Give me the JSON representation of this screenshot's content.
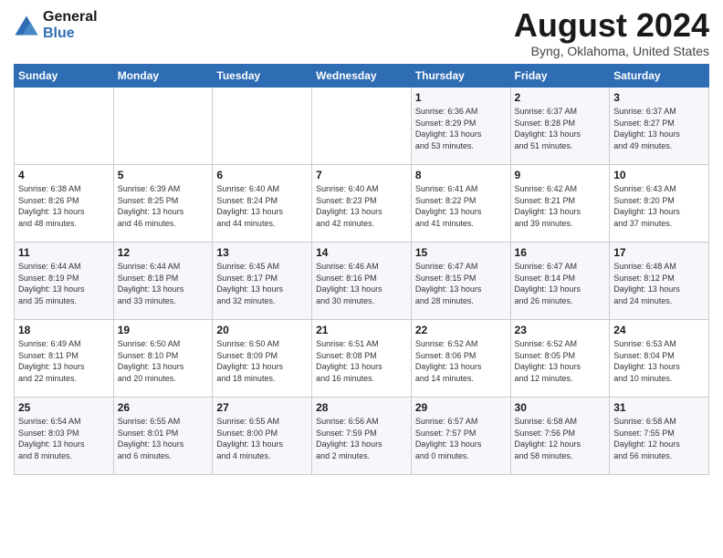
{
  "logo": {
    "line1": "General",
    "line2": "Blue"
  },
  "title": "August 2024",
  "location": "Byng, Oklahoma, United States",
  "days_of_week": [
    "Sunday",
    "Monday",
    "Tuesday",
    "Wednesday",
    "Thursday",
    "Friday",
    "Saturday"
  ],
  "weeks": [
    [
      {
        "num": "",
        "info": ""
      },
      {
        "num": "",
        "info": ""
      },
      {
        "num": "",
        "info": ""
      },
      {
        "num": "",
        "info": ""
      },
      {
        "num": "1",
        "info": "Sunrise: 6:36 AM\nSunset: 8:29 PM\nDaylight: 13 hours\nand 53 minutes."
      },
      {
        "num": "2",
        "info": "Sunrise: 6:37 AM\nSunset: 8:28 PM\nDaylight: 13 hours\nand 51 minutes."
      },
      {
        "num": "3",
        "info": "Sunrise: 6:37 AM\nSunset: 8:27 PM\nDaylight: 13 hours\nand 49 minutes."
      }
    ],
    [
      {
        "num": "4",
        "info": "Sunrise: 6:38 AM\nSunset: 8:26 PM\nDaylight: 13 hours\nand 48 minutes."
      },
      {
        "num": "5",
        "info": "Sunrise: 6:39 AM\nSunset: 8:25 PM\nDaylight: 13 hours\nand 46 minutes."
      },
      {
        "num": "6",
        "info": "Sunrise: 6:40 AM\nSunset: 8:24 PM\nDaylight: 13 hours\nand 44 minutes."
      },
      {
        "num": "7",
        "info": "Sunrise: 6:40 AM\nSunset: 8:23 PM\nDaylight: 13 hours\nand 42 minutes."
      },
      {
        "num": "8",
        "info": "Sunrise: 6:41 AM\nSunset: 8:22 PM\nDaylight: 13 hours\nand 41 minutes."
      },
      {
        "num": "9",
        "info": "Sunrise: 6:42 AM\nSunset: 8:21 PM\nDaylight: 13 hours\nand 39 minutes."
      },
      {
        "num": "10",
        "info": "Sunrise: 6:43 AM\nSunset: 8:20 PM\nDaylight: 13 hours\nand 37 minutes."
      }
    ],
    [
      {
        "num": "11",
        "info": "Sunrise: 6:44 AM\nSunset: 8:19 PM\nDaylight: 13 hours\nand 35 minutes."
      },
      {
        "num": "12",
        "info": "Sunrise: 6:44 AM\nSunset: 8:18 PM\nDaylight: 13 hours\nand 33 minutes."
      },
      {
        "num": "13",
        "info": "Sunrise: 6:45 AM\nSunset: 8:17 PM\nDaylight: 13 hours\nand 32 minutes."
      },
      {
        "num": "14",
        "info": "Sunrise: 6:46 AM\nSunset: 8:16 PM\nDaylight: 13 hours\nand 30 minutes."
      },
      {
        "num": "15",
        "info": "Sunrise: 6:47 AM\nSunset: 8:15 PM\nDaylight: 13 hours\nand 28 minutes."
      },
      {
        "num": "16",
        "info": "Sunrise: 6:47 AM\nSunset: 8:14 PM\nDaylight: 13 hours\nand 26 minutes."
      },
      {
        "num": "17",
        "info": "Sunrise: 6:48 AM\nSunset: 8:12 PM\nDaylight: 13 hours\nand 24 minutes."
      }
    ],
    [
      {
        "num": "18",
        "info": "Sunrise: 6:49 AM\nSunset: 8:11 PM\nDaylight: 13 hours\nand 22 minutes."
      },
      {
        "num": "19",
        "info": "Sunrise: 6:50 AM\nSunset: 8:10 PM\nDaylight: 13 hours\nand 20 minutes."
      },
      {
        "num": "20",
        "info": "Sunrise: 6:50 AM\nSunset: 8:09 PM\nDaylight: 13 hours\nand 18 minutes."
      },
      {
        "num": "21",
        "info": "Sunrise: 6:51 AM\nSunset: 8:08 PM\nDaylight: 13 hours\nand 16 minutes."
      },
      {
        "num": "22",
        "info": "Sunrise: 6:52 AM\nSunset: 8:06 PM\nDaylight: 13 hours\nand 14 minutes."
      },
      {
        "num": "23",
        "info": "Sunrise: 6:52 AM\nSunset: 8:05 PM\nDaylight: 13 hours\nand 12 minutes."
      },
      {
        "num": "24",
        "info": "Sunrise: 6:53 AM\nSunset: 8:04 PM\nDaylight: 13 hours\nand 10 minutes."
      }
    ],
    [
      {
        "num": "25",
        "info": "Sunrise: 6:54 AM\nSunset: 8:03 PM\nDaylight: 13 hours\nand 8 minutes."
      },
      {
        "num": "26",
        "info": "Sunrise: 6:55 AM\nSunset: 8:01 PM\nDaylight: 13 hours\nand 6 minutes."
      },
      {
        "num": "27",
        "info": "Sunrise: 6:55 AM\nSunset: 8:00 PM\nDaylight: 13 hours\nand 4 minutes."
      },
      {
        "num": "28",
        "info": "Sunrise: 6:56 AM\nSunset: 7:59 PM\nDaylight: 13 hours\nand 2 minutes."
      },
      {
        "num": "29",
        "info": "Sunrise: 6:57 AM\nSunset: 7:57 PM\nDaylight: 13 hours\nand 0 minutes."
      },
      {
        "num": "30",
        "info": "Sunrise: 6:58 AM\nSunset: 7:56 PM\nDaylight: 12 hours\nand 58 minutes."
      },
      {
        "num": "31",
        "info": "Sunrise: 6:58 AM\nSunset: 7:55 PM\nDaylight: 12 hours\nand 56 minutes."
      }
    ]
  ]
}
